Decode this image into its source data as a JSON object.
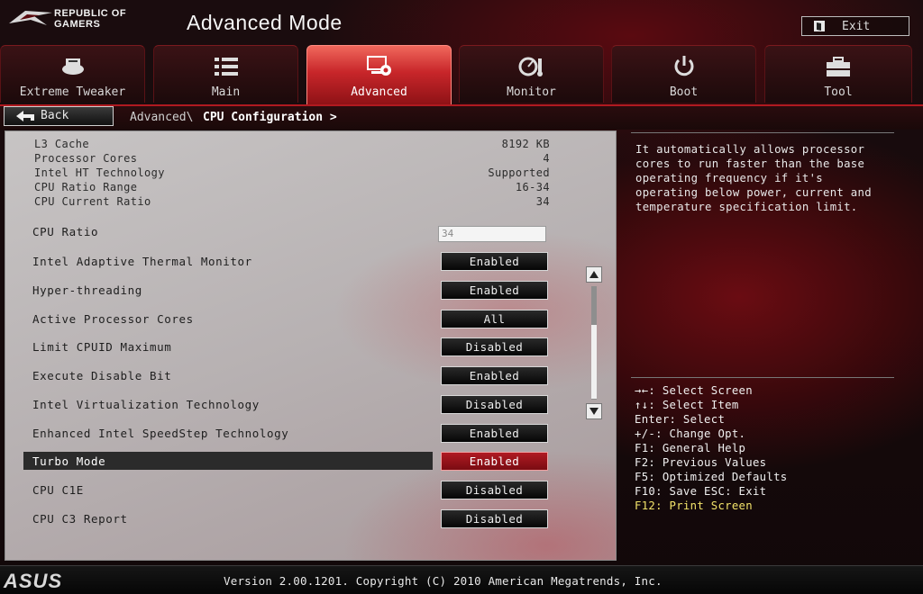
{
  "header": {
    "brand_line1": "REPUBLIC OF",
    "brand_line2": "GAMERS",
    "title": "Advanced Mode",
    "exit_label": "Exit"
  },
  "tabs": [
    {
      "label": "Extreme Tweaker",
      "icon": "extreme-tweaker-icon",
      "active": false
    },
    {
      "label": "Main",
      "icon": "list-icon",
      "active": false
    },
    {
      "label": "Advanced",
      "icon": "advanced-settings-icon",
      "active": true
    },
    {
      "label": "Monitor",
      "icon": "monitor-gauge-icon",
      "active": false
    },
    {
      "label": "Boot",
      "icon": "power-icon",
      "active": false
    },
    {
      "label": "Tool",
      "icon": "toolbox-icon",
      "active": false
    }
  ],
  "breadcrumb": {
    "back_label": "Back",
    "parent": "Advanced\\",
    "current": "CPU Configuration >"
  },
  "info": [
    {
      "label": "L3 Cache",
      "value": "8192 KB"
    },
    {
      "label": "Processor Cores",
      "value": "4"
    },
    {
      "label": "Intel HT Technology",
      "value": "Supported"
    },
    {
      "label": "CPU Ratio Range",
      "value": "16-34"
    },
    {
      "label": "CPU Current Ratio",
      "value": "34"
    }
  ],
  "cpu_ratio": {
    "label": "CPU Ratio",
    "value": "34"
  },
  "settings": [
    {
      "label": "Intel Adaptive Thermal Monitor",
      "value": "Enabled"
    },
    {
      "label": "Hyper-threading",
      "value": "Enabled"
    },
    {
      "label": "Active Processor Cores",
      "value": "All"
    },
    {
      "label": "Limit CPUID Maximum",
      "value": "Disabled"
    },
    {
      "label": "Execute Disable Bit",
      "value": "Enabled"
    },
    {
      "label": "Intel Virtualization Technology",
      "value": "Disabled"
    },
    {
      "label": "Enhanced Intel SpeedStep Technology",
      "value": "Enabled"
    },
    {
      "label": "Turbo Mode",
      "value": "Enabled",
      "selected": true
    },
    {
      "label": "CPU C1E",
      "value": "Disabled"
    },
    {
      "label": "CPU C3 Report",
      "value": "Disabled"
    }
  ],
  "help": {
    "description": "It automatically allows processor\ncores to run faster than the base\noperating frequency if it's\noperating below power, current and\ntemperature specification limit.",
    "keys": [
      "→←: Select Screen",
      "↑↓: Select Item",
      "Enter: Select",
      "+/-: Change Opt.",
      "F1: General Help",
      "F2: Previous Values",
      "F5: Optimized Defaults",
      "F10: Save  ESC: Exit",
      "F12: Print Screen"
    ]
  },
  "footer": {
    "brand": "ASUS",
    "version": "Version 2.00.1201. Copyright (C) 2010 American Megatrends, Inc."
  },
  "colors": {
    "accent_red": "#c8262a",
    "highlight_yellow": "#f2e36a"
  }
}
